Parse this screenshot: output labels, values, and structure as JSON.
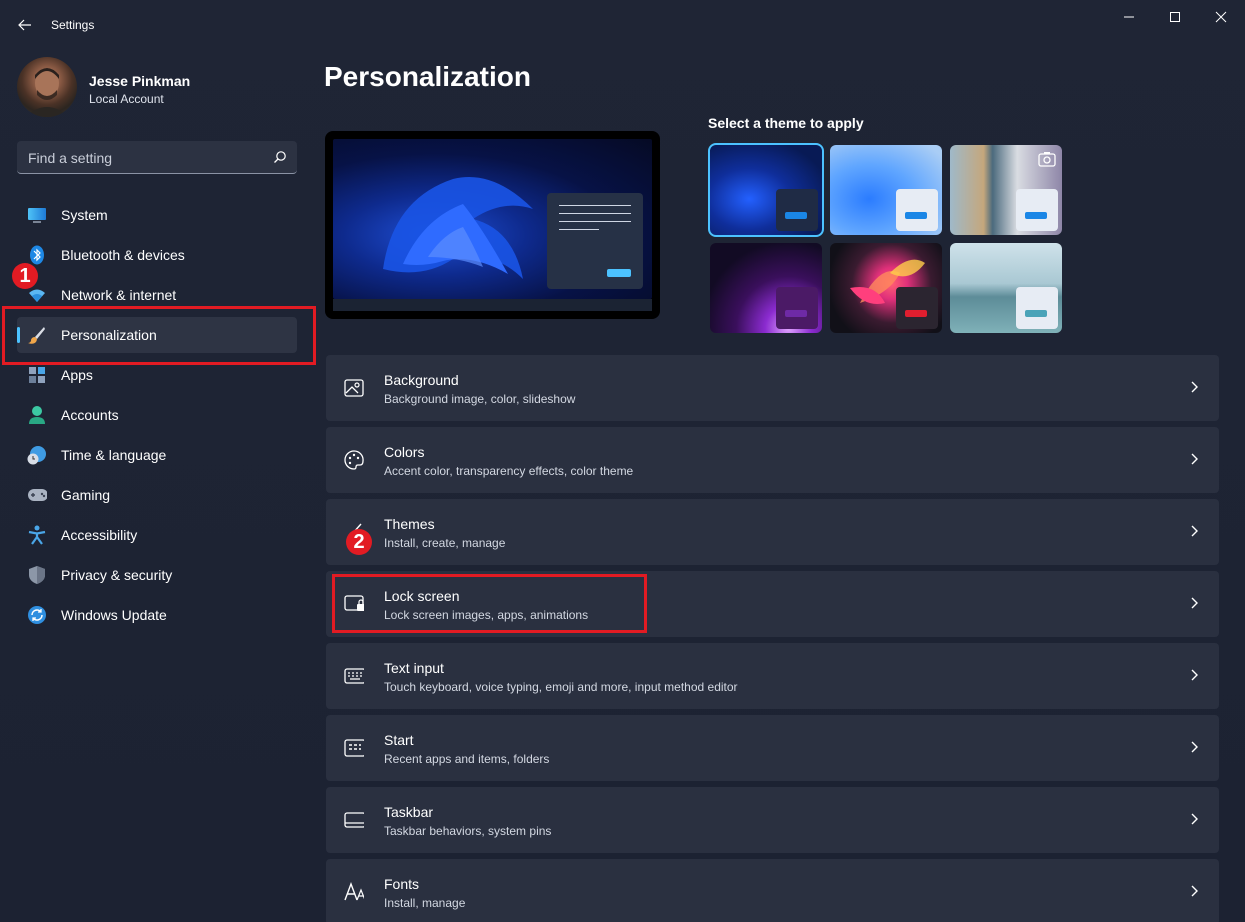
{
  "window": {
    "title": "Settings"
  },
  "user": {
    "name": "Jesse Pinkman",
    "account": "Local Account"
  },
  "search": {
    "placeholder": "Find a setting"
  },
  "sidebar": {
    "items": [
      {
        "label": "System",
        "icon": "monitor-icon"
      },
      {
        "label": "Bluetooth & devices",
        "icon": "bluetooth-icon"
      },
      {
        "label": "Network & internet",
        "icon": "wifi-icon"
      },
      {
        "label": "Personalization",
        "icon": "brush-icon",
        "active": true
      },
      {
        "label": "Apps",
        "icon": "apps-icon"
      },
      {
        "label": "Accounts",
        "icon": "person-icon"
      },
      {
        "label": "Time & language",
        "icon": "globe-clock-icon"
      },
      {
        "label": "Gaming",
        "icon": "gamepad-icon"
      },
      {
        "label": "Accessibility",
        "icon": "accessibility-icon"
      },
      {
        "label": "Privacy & security",
        "icon": "shield-icon"
      },
      {
        "label": "Windows Update",
        "icon": "update-icon"
      }
    ]
  },
  "annotations": {
    "badge_1": "1",
    "badge_2": "2"
  },
  "main": {
    "title": "Personalization",
    "theme_heading": "Select a theme to apply",
    "cards": [
      {
        "title": "Background",
        "subtitle": "Background image, color, slideshow",
        "icon": "image-icon"
      },
      {
        "title": "Colors",
        "subtitle": "Accent color, transparency effects, color theme",
        "icon": "palette-icon"
      },
      {
        "title": "Themes",
        "subtitle": "Install, create, manage",
        "icon": "brush-icon"
      },
      {
        "title": "Lock screen",
        "subtitle": "Lock screen images, apps, animations",
        "icon": "lock-screen-icon"
      },
      {
        "title": "Text input",
        "subtitle": "Touch keyboard, voice typing, emoji and more, input method editor",
        "icon": "keyboard-icon"
      },
      {
        "title": "Start",
        "subtitle": "Recent apps and items, folders",
        "icon": "start-icon"
      },
      {
        "title": "Taskbar",
        "subtitle": "Taskbar behaviors, system pins",
        "icon": "taskbar-icon"
      },
      {
        "title": "Fonts",
        "subtitle": "Install, manage",
        "icon": "fonts-icon"
      }
    ]
  },
  "colors": {
    "accent": "#4cc2ff",
    "annotation": "#e21b23"
  }
}
